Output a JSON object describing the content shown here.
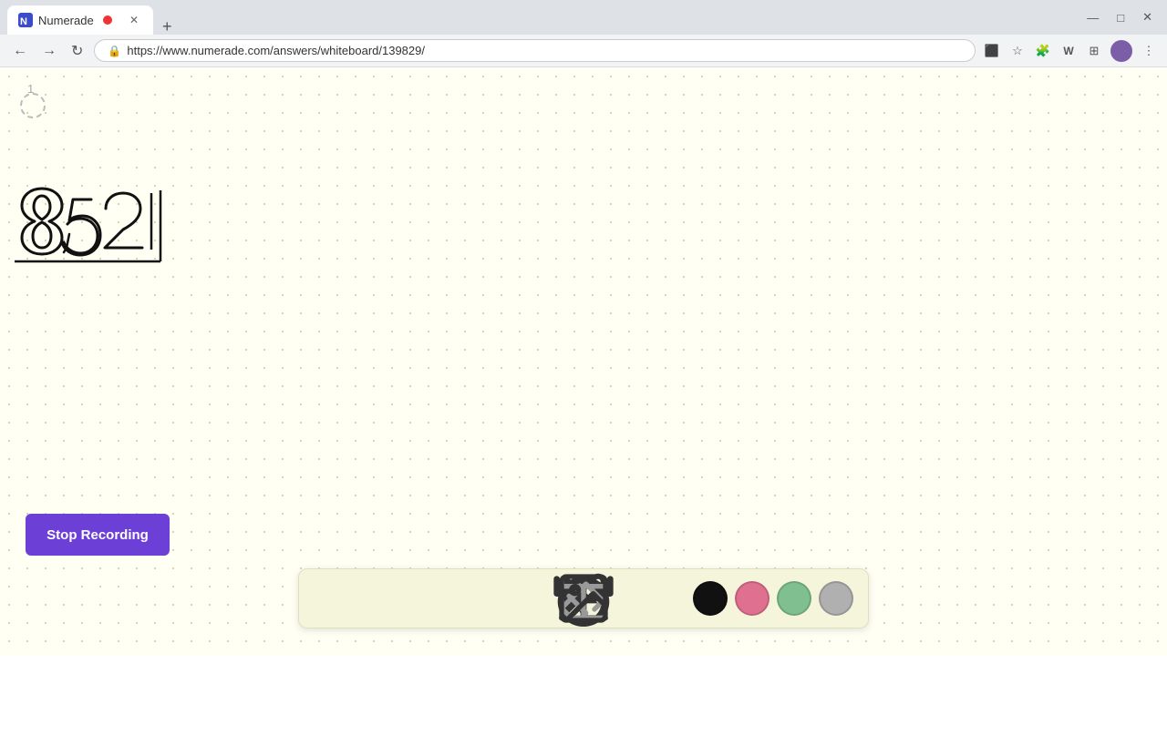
{
  "browser": {
    "tab_title": "Numerade",
    "tab_url": "https://www.numerade.com/answers/whiteboard/139829/",
    "new_tab_label": "+",
    "nav": {
      "back": "←",
      "forward": "→",
      "reload": "↻"
    },
    "window_controls": {
      "minimize": "—",
      "maximize": "□",
      "close": "✕"
    },
    "address_bar": {
      "lock_icon": "🔒",
      "url_text": "https://www.numerade.com/answers/whiteboard/139829/"
    }
  },
  "whiteboard": {
    "page_number": "1"
  },
  "toolbar": {
    "undo_label": "↺",
    "redo_label": "↻",
    "select_label": "▲",
    "pen_label": "✏",
    "add_label": "+",
    "eraser_label": "◈",
    "text_label": "A",
    "image_label": "🖼",
    "colors": [
      {
        "name": "black",
        "value": "#111111"
      },
      {
        "name": "pink",
        "value": "#e07090"
      },
      {
        "name": "green",
        "value": "#80c090"
      },
      {
        "name": "gray",
        "value": "#b0b0b0"
      }
    ]
  },
  "stop_recording": {
    "label": "Stop Recording"
  }
}
